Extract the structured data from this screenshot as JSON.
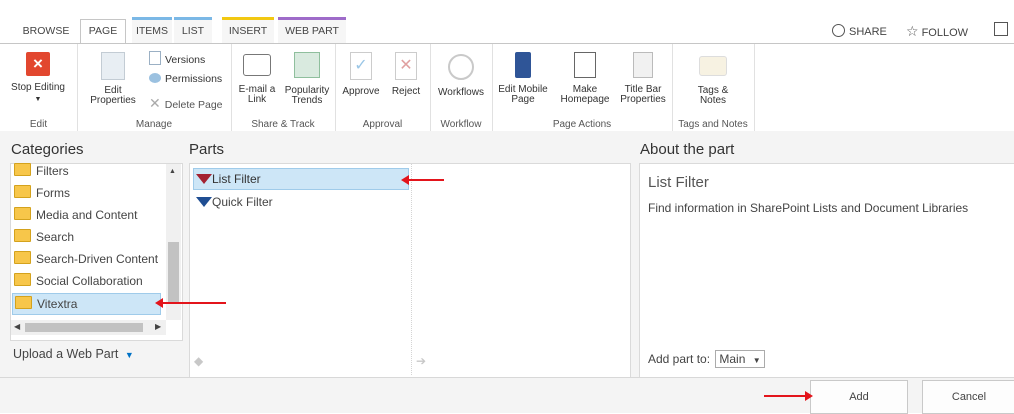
{
  "tabs": [
    "BROWSE",
    "PAGE",
    "ITEMS",
    "LIST",
    "INSERT",
    "WEB PART"
  ],
  "top_right": {
    "share": "SHARE",
    "follow": "FOLLOW"
  },
  "ribbon": {
    "stop_editing": "Stop Editing",
    "edit_properties": "Edit Properties",
    "versions": "Versions",
    "permissions": "Permissions",
    "delete_page": "Delete Page",
    "email_link": "E-mail a Link",
    "popularity_trends": "Popularity Trends",
    "approve": "Approve",
    "reject": "Reject",
    "workflows": "Workflows",
    "edit_mobile_page": "Edit Mobile Page",
    "make_homepage": "Make Homepage",
    "title_bar_properties": "Title Bar Properties",
    "tags_notes": "Tags & Notes",
    "groups": [
      "Edit",
      "Manage",
      "Share & Track",
      "Approval",
      "Workflow",
      "Page Actions",
      "Tags and Notes"
    ]
  },
  "categories": {
    "header": "Categories",
    "items": [
      "Filters",
      "Forms",
      "Media and Content",
      "Search",
      "Search-Driven Content",
      "Social Collaboration",
      "Vitextra"
    ],
    "selected": "Vitextra",
    "upload": "Upload a Web Part"
  },
  "parts": {
    "header": "Parts",
    "items": [
      "List Filter",
      "Quick Filter"
    ]
  },
  "about": {
    "header": "About the part",
    "title": "List Filter",
    "description": "Find information in SharePoint Lists and Document Libraries",
    "add_to_label": "Add part to:",
    "zone": "Main"
  },
  "buttons": {
    "add": "Add",
    "cancel": "Cancel"
  },
  "colors": {
    "accent_insert": "#f2c811",
    "accent_webpart": "#9e6bc9",
    "accent_list": "#7bb8e6",
    "arrow": "#e3141b"
  }
}
